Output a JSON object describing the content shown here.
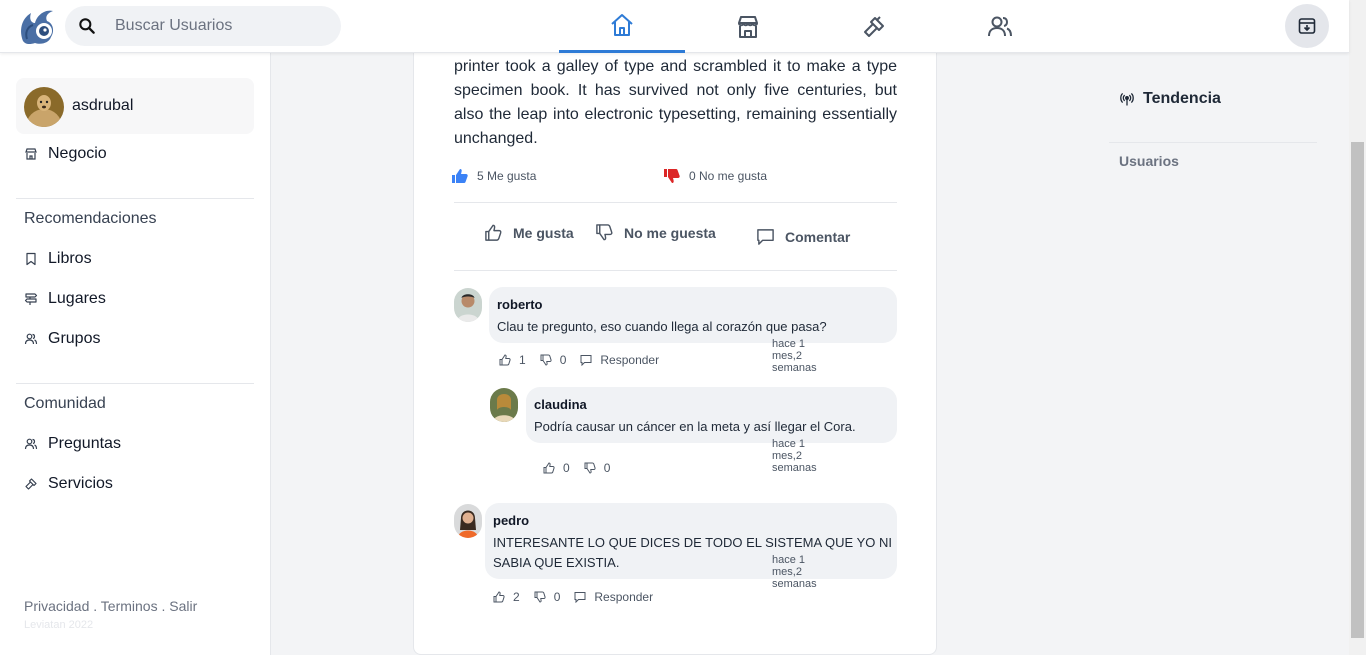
{
  "search": {
    "placeholder": "Buscar Usuarios"
  },
  "nav": {
    "tabs": [
      {
        "icon": "home-icon",
        "active": true
      },
      {
        "icon": "store-icon",
        "active": false
      },
      {
        "icon": "hammer-icon",
        "active": false
      },
      {
        "icon": "users-icon",
        "active": false
      }
    ],
    "inbox_icon": "inbox-icon"
  },
  "sidebar": {
    "profile_name": "asdrubal",
    "business": "Negocio",
    "recommendations_title": "Recomendaciones",
    "recommendations": [
      "Libros",
      "Lugares",
      "Grupos"
    ],
    "community_title": "Comunidad",
    "community": [
      "Preguntas",
      "Servicios"
    ],
    "footer": {
      "privacy": "Privacidad",
      "terms": "Terminos",
      "exit": "Salir",
      "sep": " . "
    },
    "copyright": "Leviatan 2022"
  },
  "right_panel": {
    "trend_title": "Tendencia",
    "users_title": "Usuarios"
  },
  "post": {
    "text": "printer took a galley of type and scrambled it to make a type specimen book. It has survived not only five centuries, but also the leap into electronic typesetting, remaining essentially unchanged.",
    "likes_text": "5 Me gusta",
    "dislikes_text": "0 No me gusta",
    "like_action": "Me gusta",
    "dislike_action": "No me guesta",
    "comment_action": "Comentar"
  },
  "comments": [
    {
      "name": "roberto",
      "text": "Clau te pregunto, eso cuando llega al corazón que pasa?",
      "time": "hace 1 mes,2 semanas",
      "likes": "1",
      "dislikes": "0",
      "reply": "Responder"
    },
    {
      "name": "claudina",
      "text": "Podría causar un cáncer en la meta y así llegar el Cora.",
      "time": "hace 1 mes,2 semanas",
      "likes": "0",
      "dislikes": "0"
    },
    {
      "name": "pedro",
      "text_line1": "INTERESANTE LO QUE DICES DE TODO EL SISTEMA QUE YO NI",
      "text_line2": "SABIA QUE EXISTIA.",
      "time": "hace 1 mes,2 semanas",
      "likes": "2",
      "dislikes": "0",
      "reply": "Responder"
    }
  ],
  "colors": {
    "accent": "#2e7bd6",
    "like": "#3b82f6",
    "dislike": "#dc2626",
    "page_bg": "#f3f4f6"
  }
}
